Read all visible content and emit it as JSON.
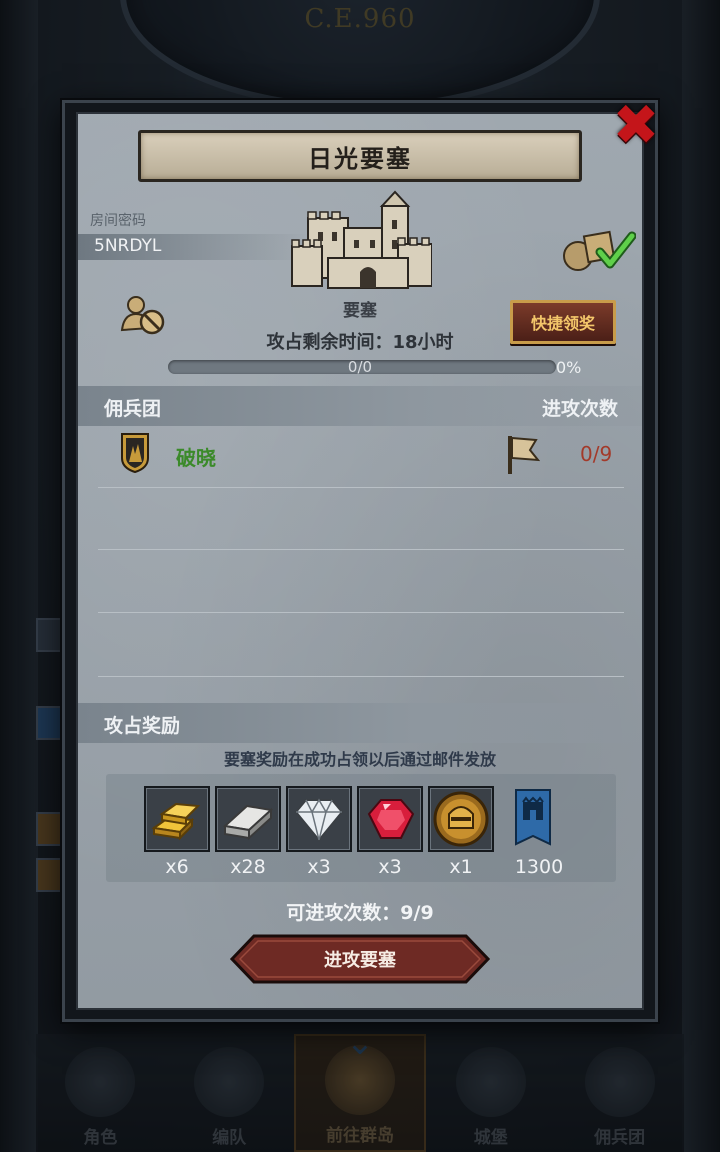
{
  "background": {
    "era": "C.E.960"
  },
  "bottom_nav": [
    {
      "label": "角色",
      "icon": "knight-icon"
    },
    {
      "label": "编队",
      "icon": "formation-icon"
    },
    {
      "label": "前往群岛",
      "icon": "islands-compass-icon",
      "active": true
    },
    {
      "label": "城堡",
      "icon": "castle-icon"
    },
    {
      "label": "佣兵团",
      "icon": "mercenary-icon"
    }
  ],
  "modal": {
    "title": "日光要塞",
    "room_label": "房间密码",
    "room_code": "5NRDYL",
    "fortress_label": "要塞",
    "quick_claim_label": "快捷领奖",
    "time_left": "攻占剩余时间：18小时",
    "progress": {
      "text": "0/0",
      "percent_text": "0%",
      "fraction": 0
    },
    "mercenary_header": "佣兵团",
    "attack_count_header": "进攻次数",
    "mercenary": {
      "name": "破晓",
      "attacks": "0/9"
    },
    "reward_header": "攻占奖励",
    "reward_note": "要塞奖励在成功占领以后通过邮件发放",
    "rewards": [
      {
        "icon": "gold-bar-icon",
        "qty": "x6"
      },
      {
        "icon": "silver-bar-icon",
        "qty": "x28"
      },
      {
        "icon": "diamond-icon",
        "qty": "x3"
      },
      {
        "icon": "ruby-icon",
        "qty": "x3"
      },
      {
        "icon": "helmet-coin-icon",
        "qty": "x1"
      },
      {
        "icon": "guild-banner-icon",
        "qty": "1300"
      }
    ],
    "attempts_text": "可进攻次数：9/9",
    "attack_button_label": "进攻要塞"
  },
  "colors": {
    "panel": "#9aa3ab",
    "close": "#c4151a",
    "mercenary_name": "#3b8a2a",
    "attack_count": "#a33a2a",
    "attack_button": "#6e2a24"
  }
}
